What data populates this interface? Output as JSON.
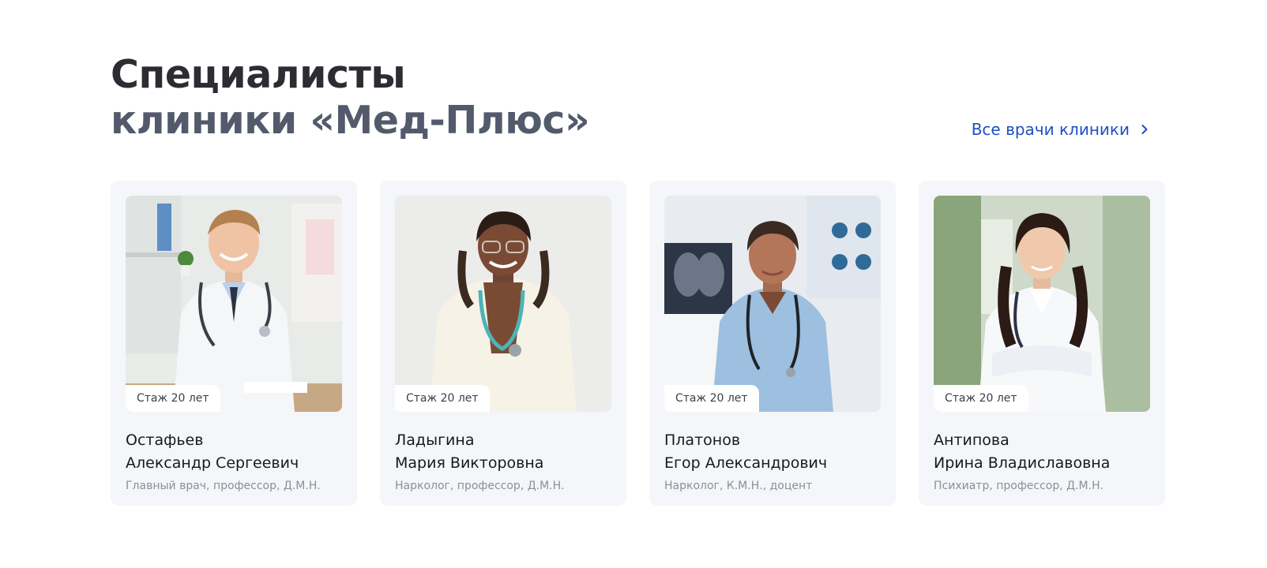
{
  "section": {
    "title_line1": "Специалисты",
    "title_line2": "клиники «Мед-Плюс»",
    "all_doctors_link": "Все врачи клиники"
  },
  "doctors": [
    {
      "last_name": "Остафьев",
      "first_names": "Александр Сергеевич",
      "role": "Главный врач, профессор, Д.М.Н.",
      "experience": "Стаж 20 лет"
    },
    {
      "last_name": "Ладыгина",
      "first_names": "Мария Викторовна",
      "role": "Нарколог, профессор, Д.М.Н.",
      "experience": "Стаж 20 лет"
    },
    {
      "last_name": "Платонов",
      "first_names": "Егор Александрович",
      "role": "Нарколог, К.М.Н., доцент",
      "experience": "Стаж 20 лет"
    },
    {
      "last_name": "Антипова",
      "first_names": "Ирина Владиславовна",
      "role": "Психиатр, профессор, Д.М.Н.",
      "experience": "Стаж 20 лет"
    }
  ],
  "icons": {
    "link_arrow": "chevron-right-icon"
  },
  "colors": {
    "accent": "#1d4fc4",
    "card_bg": "#f5f6fa",
    "title_dark": "#2b2d33",
    "title_muted": "#525a6b"
  }
}
